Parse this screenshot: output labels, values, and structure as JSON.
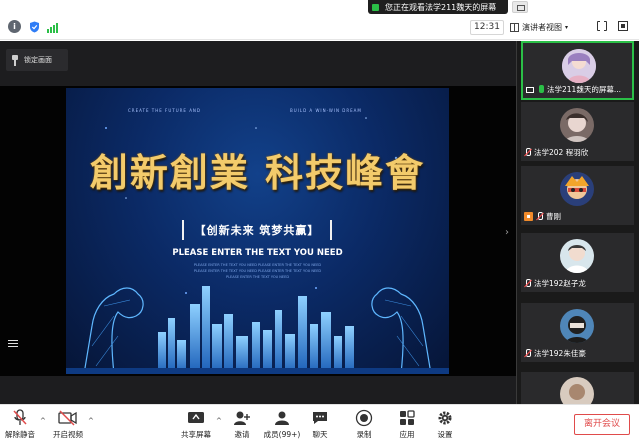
{
  "banner": {
    "text": "您正在观看法学211魏天的屏幕"
  },
  "topbar": {
    "timer": "12:31",
    "view_label": "演讲者视图"
  },
  "stage": {
    "lock_label": "锁定画面"
  },
  "slide": {
    "tagline_left": "CREATE THE FUTURE AND",
    "tagline_right": "BUILD A WIN-WIN DREAM",
    "title": "創新創業 科技峰會",
    "subtitle": "【创新未来 筑梦共赢】",
    "enter_text": "PLEASE ENTER THE TEXT YOU NEED",
    "small_line_1": "PLEASE ENTER THE TEXT YOU NEED PLEASE ENTER THE TEXT YOU NEED",
    "small_line_2": "PLEASE ENTER THE TEXT YOU NEED PLEASE ENTER THE TEXT YOU NEED",
    "small_line_3": "PLEASE ENTER THE TEXT YOU NEED"
  },
  "participants": [
    {
      "name": "法学211魏天的屏幕...",
      "mic": "on",
      "extra": "screen"
    },
    {
      "name": "法学202 程羽欣",
      "mic": "off",
      "extra": ""
    },
    {
      "name": "曹刚",
      "mic": "off",
      "extra": "host"
    },
    {
      "name": "法学192赵子龙",
      "mic": "off",
      "extra": ""
    },
    {
      "name": "法学192朱佳豪",
      "mic": "off",
      "extra": ""
    }
  ],
  "toolbar": {
    "unmute": "解除静音",
    "video": "开启视频",
    "share": "共享屏幕",
    "invite": "邀请",
    "members": "成员(99+)",
    "chat": "聊天",
    "record": "录制",
    "apps": "应用",
    "settings": "设置",
    "leave": "离开会议"
  },
  "colors": {
    "accent": "#2bbf47",
    "danger": "#e04b4b",
    "slide_bg": "#0b2a66",
    "title_gold": "#f3cb6b"
  }
}
